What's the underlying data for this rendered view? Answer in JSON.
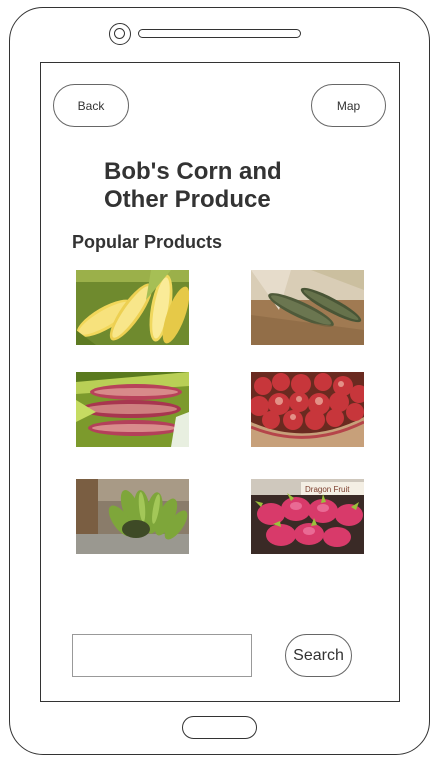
{
  "header": {
    "back_label": "Back",
    "map_label": "Map"
  },
  "page": {
    "title": "Bob's Corn and Other Produce",
    "section_heading": "Popular Products"
  },
  "products": [
    {
      "icon": "yellow-corn-photo"
    },
    {
      "icon": "dark-corn-photo"
    },
    {
      "icon": "red-striped-corn-photo"
    },
    {
      "icon": "apples-basket-photo"
    },
    {
      "icon": "green-bananas-photo"
    },
    {
      "icon": "dragon-fruit-photo",
      "sign_text": "Dragon Fruit"
    }
  ],
  "search": {
    "value": "",
    "placeholder": "",
    "button_label": "Search"
  }
}
